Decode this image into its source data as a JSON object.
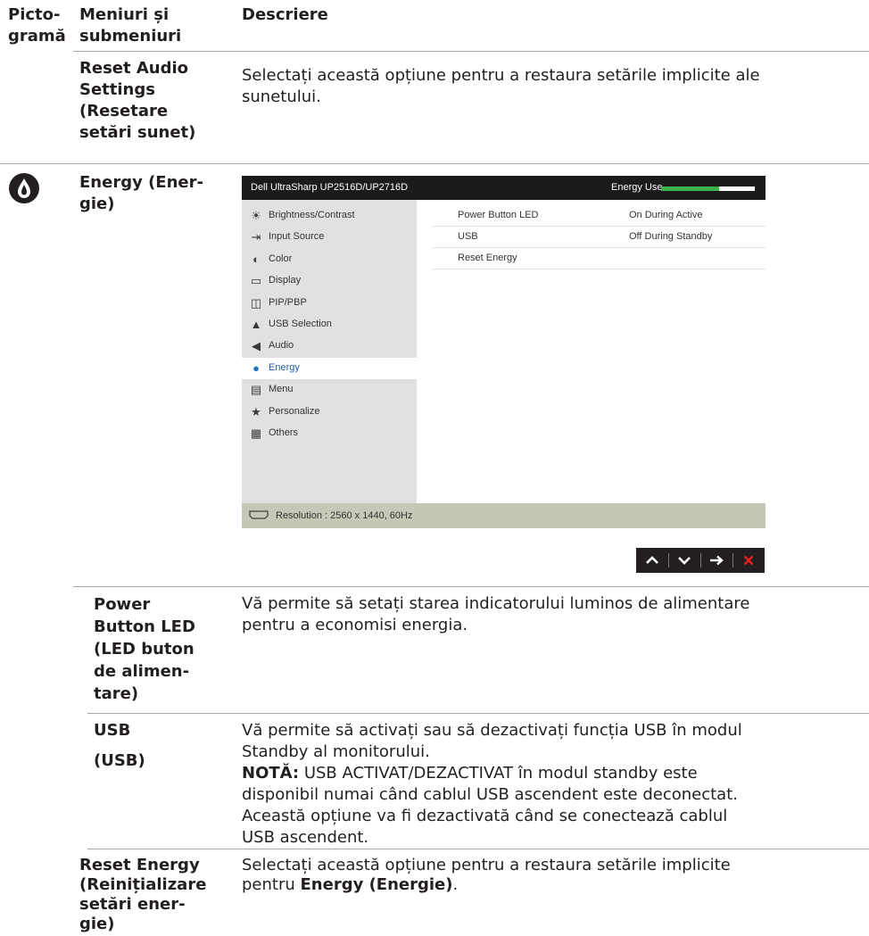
{
  "headers": {
    "icon_col_line1": "Picto-",
    "icon_col_line2": "gramă",
    "menu_col_line1": "Meniuri și",
    "menu_col_line2": "submeniuri",
    "desc_col": "Descriere"
  },
  "reset_audio": {
    "name_lines": [
      "Reset Audio",
      "Settings",
      "(Resetare",
      "setări sunet)"
    ],
    "desc_lines": [
      "Selectați această opțiune pentru a restaura setările implicite ale",
      "sunetului."
    ]
  },
  "energy": {
    "name_lines": [
      "Energy (Ener-",
      "gie)"
    ]
  },
  "osd": {
    "model": "Dell UltraSharp UP2516D/UP2716D",
    "energy_use_label": "Energy Use",
    "energy_use_level": 0.62,
    "menu": [
      {
        "label": "Brightness/Contrast",
        "icon": "brightness-icon",
        "glyph": "☀"
      },
      {
        "label": "Input Source",
        "icon": "input-source-icon",
        "glyph": "⇥"
      },
      {
        "label": "Color",
        "icon": "color-icon",
        "glyph": "◐"
      },
      {
        "label": "Display",
        "icon": "display-icon",
        "glyph": "▭"
      },
      {
        "label": "PIP/PBP",
        "icon": "pip-pbp-icon",
        "glyph": "◫"
      },
      {
        "label": "USB Selection",
        "icon": "usb-selection-icon",
        "glyph": "▲"
      },
      {
        "label": "Audio",
        "icon": "audio-icon",
        "glyph": "◀"
      },
      {
        "label": "Energy",
        "icon": "energy-icon",
        "glyph": "●"
      },
      {
        "label": "Menu",
        "icon": "menu-icon",
        "glyph": "▤"
      },
      {
        "label": "Personalize",
        "icon": "star-icon",
        "glyph": "★"
      },
      {
        "label": "Others",
        "icon": "others-icon",
        "glyph": "▦"
      }
    ],
    "active_index": 7,
    "settings": [
      {
        "name": "Power Button LED",
        "value": "On During Active"
      },
      {
        "name": "USB",
        "value": "Off During Standby"
      },
      {
        "name": "Reset Energy",
        "value": ""
      }
    ],
    "resolution": "Resolution : 2560 x 1440, 60Hz",
    "colors": {
      "accent_green": "#3bb54a",
      "active_blue": "#1f5fa8",
      "footer": "#c7c7b8"
    }
  },
  "nav_buttons": [
    {
      "name": "up-button",
      "glyph": "⌃"
    },
    {
      "name": "down-button",
      "glyph": "⌄"
    },
    {
      "name": "enter-button",
      "glyph": "→"
    },
    {
      "name": "exit-button",
      "glyph": "✕"
    }
  ],
  "power_led": {
    "name_lines": [
      "Power",
      "Button LED",
      "(LED buton",
      "de alimen-",
      "tare)"
    ],
    "desc_lines": [
      "Vă permite să setați starea indicatorului luminos de alimentare",
      "pentru a economisi energia."
    ]
  },
  "usb": {
    "name_line1": "USB",
    "name_line2": "(USB)",
    "desc_lines": [
      "Vă permite să activați sau să dezactivați funcția USB în modul",
      "Standby al monitorului."
    ],
    "note_label": "NOTĂ:",
    "note_first": " USB ACTIVAT/DEZACTIVAT în modul standby este",
    "note_lines": [
      "disponibil numai când cablul USB ascendent este deconectat.",
      "Această opțiune va fi dezactivată când se conectează cablul",
      "USB ascendent."
    ]
  },
  "reset_energy": {
    "name_lines": [
      "Reset Energy",
      "(Reinițializare",
      "setări ener-",
      "gie)"
    ],
    "desc_line1": "Selectați această opțiune pentru a restaura setările implicite",
    "desc_line2_pre": "pentru ",
    "desc_line2_bold": "Energy (Energie)",
    "desc_line2_post": "."
  }
}
